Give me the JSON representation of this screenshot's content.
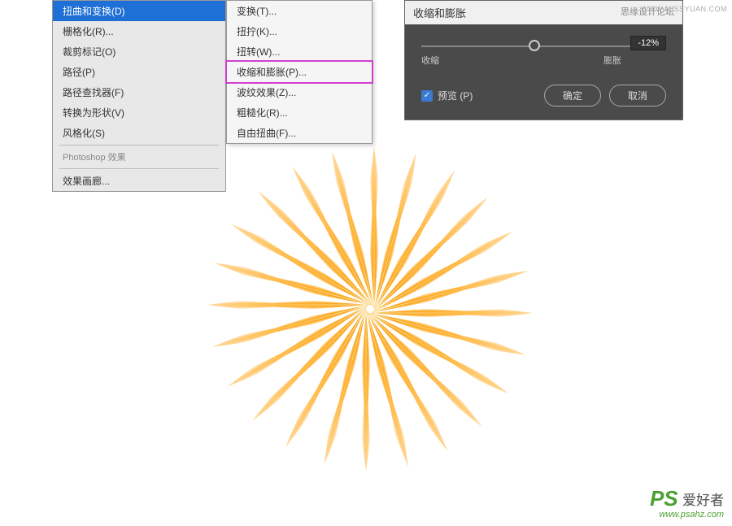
{
  "left_menu": {
    "items": [
      "扭曲和变换(D)",
      "栅格化(R)...",
      "裁剪标记(O)",
      "路径(P)",
      "路径查找器(F)",
      "转换为形状(V)",
      "风格化(S)"
    ],
    "section_label": "Photoshop 效果",
    "effects_item": "效果画廊..."
  },
  "submenu": {
    "items": [
      "变换(T)...",
      "扭拧(K)...",
      "扭转(W)...",
      "收缩和膨胀(P)...",
      "波纹效果(Z)...",
      "粗糙化(R)...",
      "自由扭曲(F)..."
    ],
    "highlighted_index": 3
  },
  "dialog": {
    "title": "收缩和膨胀",
    "title_right": "思缘设计论坛",
    "slider_min_label": "收缩",
    "slider_max_label": "膨胀",
    "slider_value": "-12%",
    "preview_label": "预览 (P)",
    "ok_label": "确定",
    "cancel_label": "取消"
  },
  "watermark": {
    "top": "WWW.MISSYUAN.COM",
    "ps": "PS",
    "label": "爱好者",
    "url": "www.psahz.com"
  }
}
